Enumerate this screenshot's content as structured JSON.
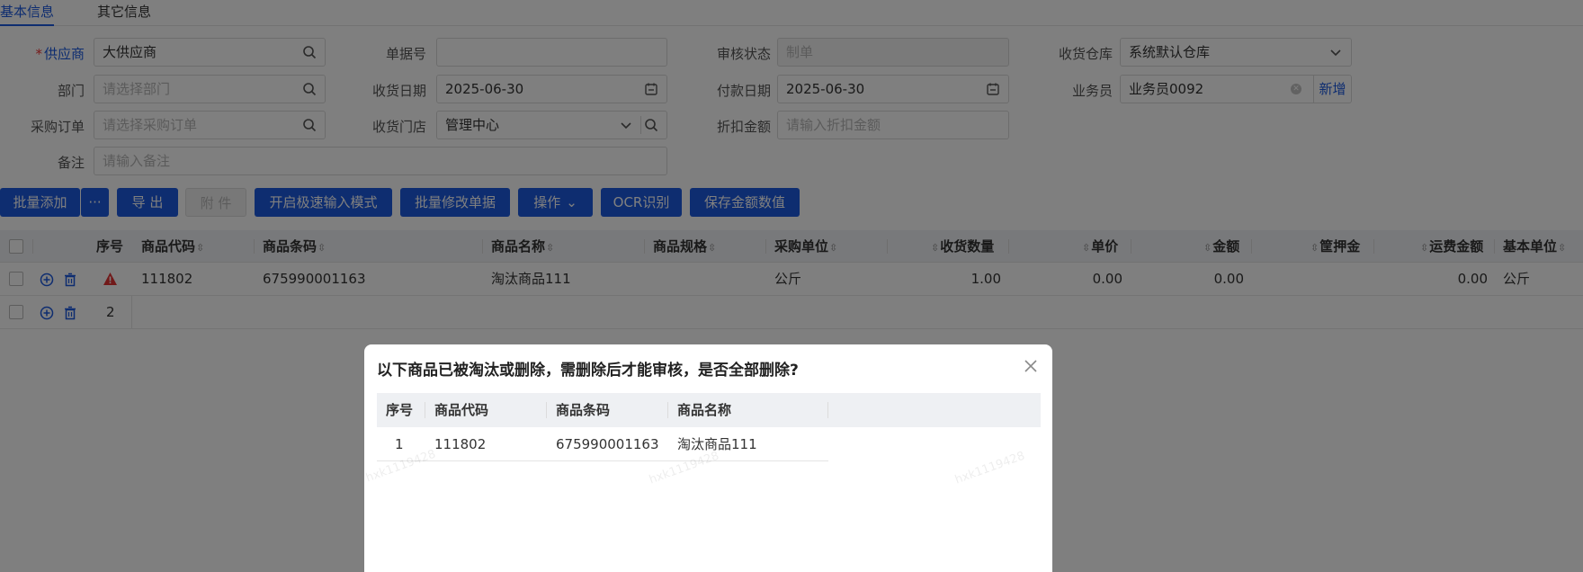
{
  "tabs": [
    "基本信息",
    "其它信息"
  ],
  "form": {
    "supplier": {
      "label": "供应商",
      "value": "大供应商"
    },
    "doc_no": {
      "label": "单据号",
      "value": ""
    },
    "audit_status": {
      "label": "审核状态",
      "placeholder": "制单"
    },
    "warehouse": {
      "label": "收货仓库",
      "value": "系统默认仓库"
    },
    "dept": {
      "label": "部门",
      "placeholder": "请选择部门"
    },
    "receive_date": {
      "label": "收货日期",
      "value": "2025-06-30"
    },
    "pay_date": {
      "label": "付款日期",
      "value": "2025-06-30"
    },
    "salesman": {
      "label": "业务员",
      "value": "业务员0092",
      "add": "新增"
    },
    "po": {
      "label": "采购订单",
      "placeholder": "请选择采购订单"
    },
    "store": {
      "label": "收货门店",
      "value": "管理中心"
    },
    "discount": {
      "label": "折扣金额",
      "placeholder": "请输入折扣金额"
    },
    "remark": {
      "label": "备注",
      "placeholder": "请输入备注"
    }
  },
  "toolbar": {
    "batch_add": "批量添加",
    "more": "···",
    "export": "导 出",
    "attach": "附 件",
    "fast_mode": "开启极速输入模式",
    "batch_edit": "批量修改单据",
    "ops": "操作",
    "ocr": "OCR识别",
    "save_amount": "保存金额数值"
  },
  "table": {
    "headers": [
      "序号",
      "商品代码",
      "商品条码",
      "商品名称",
      "商品规格",
      "采购单位",
      "收货数量",
      "单价",
      "金额",
      "筐押金",
      "运费金额",
      "基本单位"
    ],
    "rows": [
      {
        "code": "111802",
        "barcode": "675990001163",
        "name": "淘汰商品111",
        "unit": "公斤",
        "qty": "1.00",
        "price": "0.00",
        "amount": "0.00",
        "freight": "0.00",
        "base_unit": "公斤"
      },
      {
        "seq": "2"
      }
    ]
  },
  "modal": {
    "title": "以下商品已被淘汰或删除，需删除后才能审核，是否全部删除?",
    "headers": [
      "序号",
      "商品代码",
      "商品条码",
      "商品名称"
    ],
    "rows": [
      {
        "seq": "1",
        "code": "111802",
        "barcode": "675990001163",
        "name": "淘汰商品111"
      }
    ],
    "watermark": "hxk1119428"
  },
  "colors": {
    "primary": "#1d5ae0",
    "warning": "#e33333"
  }
}
